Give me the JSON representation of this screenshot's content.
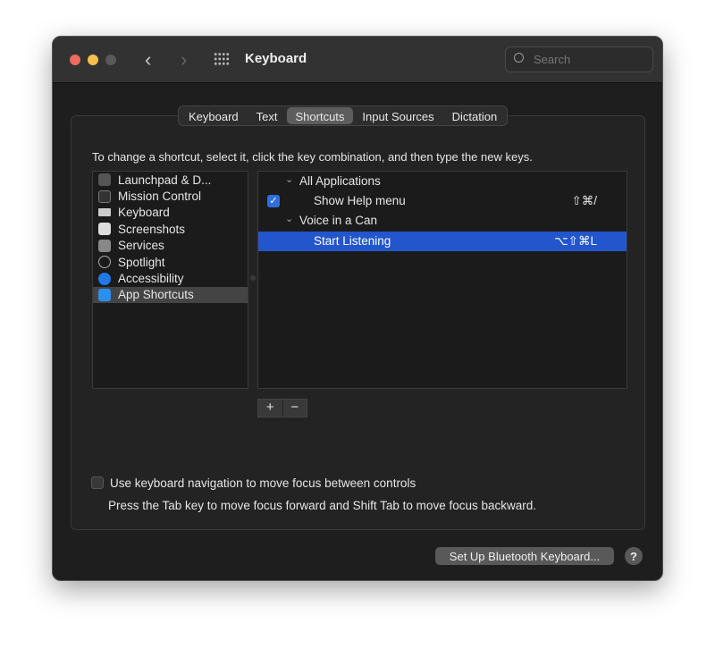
{
  "window": {
    "title": "Keyboard",
    "search_placeholder": "Search"
  },
  "tabs": [
    {
      "label": "Keyboard"
    },
    {
      "label": "Text"
    },
    {
      "label": "Shortcuts",
      "selected": true
    },
    {
      "label": "Input Sources"
    },
    {
      "label": "Dictation"
    }
  ],
  "instructions": "To change a shortcut, select it, click the key combination, and then type the new keys.",
  "categories": [
    {
      "label": "Launchpad & D...",
      "icon": "launchpad-icon"
    },
    {
      "label": "Mission Control",
      "icon": "mission-control-icon"
    },
    {
      "label": "Keyboard",
      "icon": "keyboard-icon"
    },
    {
      "label": "Screenshots",
      "icon": "screenshot-icon"
    },
    {
      "label": "Services",
      "icon": "gear-icon"
    },
    {
      "label": "Spotlight",
      "icon": "magnifier-icon"
    },
    {
      "label": "Accessibility",
      "icon": "accessibility-icon"
    },
    {
      "label": "App Shortcuts",
      "icon": "app-store-icon",
      "selected": true
    }
  ],
  "shortcuts": {
    "group1": "All Applications",
    "item1": {
      "label": "Show Help menu",
      "keys": "⇧⌘/",
      "checked": true
    },
    "group2": "Voice in a Can",
    "item2": {
      "label": "Start Listening",
      "keys": "⌥⇧⌘L",
      "selected": true
    }
  },
  "add_label": "+",
  "remove_label": "−",
  "keyboard_nav": {
    "label": "Use keyboard navigation to move focus between controls",
    "checked": false,
    "hint": "Press the Tab key to move focus forward and Shift Tab to move focus backward."
  },
  "bluetooth_button": "Set Up Bluetooth Keyboard...",
  "help_label": "?",
  "colors": {
    "accent": "#2355cc",
    "close": "#ed6a5e",
    "minimize": "#f5bf4f"
  }
}
